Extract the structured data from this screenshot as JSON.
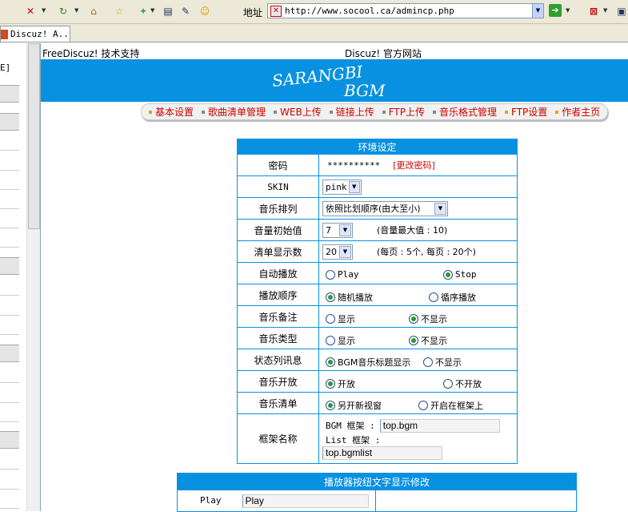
{
  "browser": {
    "address_label": "地址",
    "url": "http://www.socool.ca/admincp.php",
    "tab_title": "Discuz! A..."
  },
  "left_frame": {
    "code_text": "E]"
  },
  "top_links": {
    "left": "FreeDiscuz! 技术支持",
    "center": "Discuz! 官方网站"
  },
  "banner": {
    "line1": "SARANGBI",
    "line2": "BGM",
    "bg_color": "#0891e0"
  },
  "menu": [
    {
      "label": "基本设置"
    },
    {
      "label": "歌曲清单管理"
    },
    {
      "label": "WEB上传"
    },
    {
      "label": "链接上传"
    },
    {
      "label": "FTP上传"
    },
    {
      "label": "音乐格式管理"
    },
    {
      "label": "FTP设置"
    },
    {
      "label": "作者主页"
    }
  ],
  "env": {
    "title": "环境设定",
    "password": {
      "label": "密码",
      "value": "**********",
      "change_link": "[更改密码]"
    },
    "skin": {
      "label": "SKIN",
      "value": "pink"
    },
    "sort": {
      "label": "音乐排列",
      "value": "依照比划顺序(由大至小)"
    },
    "volume": {
      "label": "音量初始值",
      "value": "7",
      "note": "(音量最大值 : 10)"
    },
    "list_count": {
      "label": "清单显示数",
      "value": "20",
      "note": "(每页 : 5个, 每页 : 20个)"
    },
    "autoplay": {
      "label": "自动播放",
      "opt1": "Play",
      "opt2": "Stop",
      "selected": 2
    },
    "play_order": {
      "label": "播放顺序",
      "opt1": "随机播放",
      "opt2": "循序播放",
      "selected": 1
    },
    "remark": {
      "label": "音乐备注",
      "opt1": "显示",
      "opt2": "不显示",
      "selected": 2
    },
    "type": {
      "label": "音乐类型",
      "opt1": "显示",
      "opt2": "不显示",
      "selected": 2
    },
    "status": {
      "label": "状态列讯息",
      "opt1": "BGM音乐标题显示",
      "opt2": "不显示",
      "selected": 1
    },
    "open": {
      "label": "音乐开放",
      "opt1": "开放",
      "opt2": "不开放",
      "selected": 1
    },
    "playlist": {
      "label": "音乐清单",
      "opt1": "另开新视窗",
      "opt2": "开启在框架上",
      "selected": 1
    },
    "frame": {
      "label": "框架名称",
      "bgm_label": "BGM 框架 :",
      "bgm_value": "top.bgm",
      "list_label": "List 框架 :",
      "list_value": "top.bgmlist"
    }
  },
  "player": {
    "title": "播放器按纽文字显示修改",
    "play_label": "Play",
    "play_value": "Play"
  }
}
